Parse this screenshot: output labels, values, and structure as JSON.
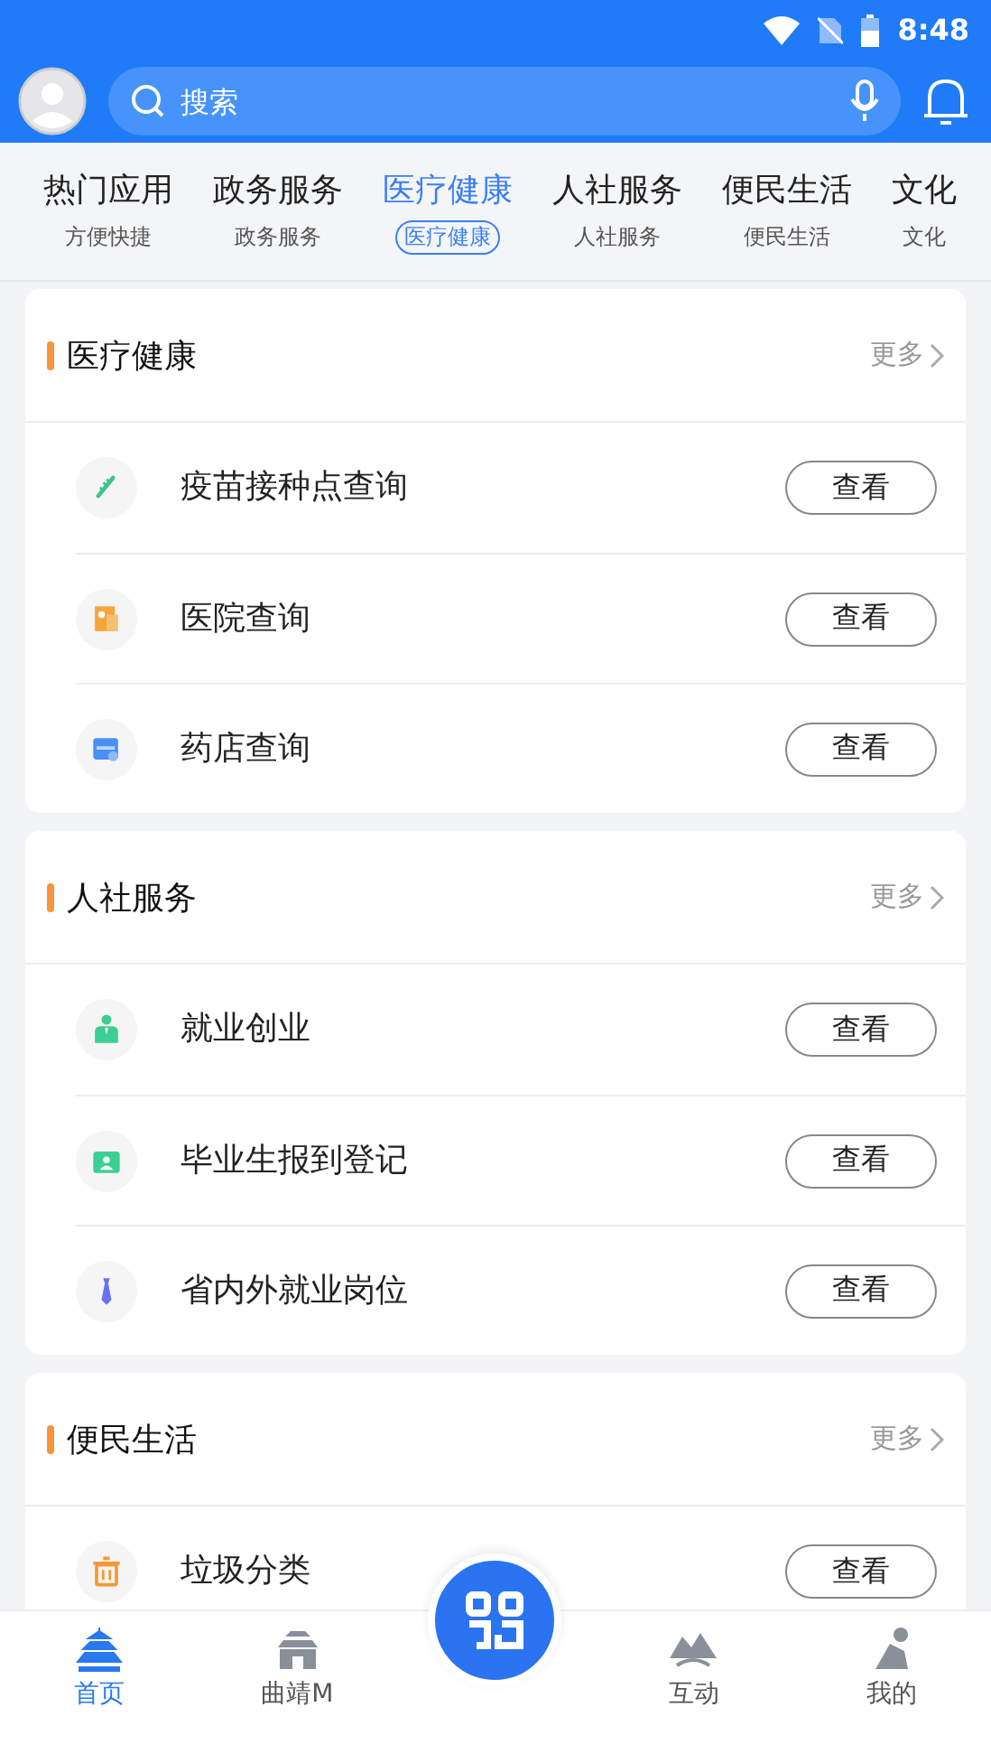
{
  "status_bar": {
    "time": "8:48"
  },
  "search": {
    "placeholder": "搜索"
  },
  "tabs": [
    {
      "label": "热门应用",
      "sub": "方便快捷",
      "selected": false
    },
    {
      "label": "政务服务",
      "sub": "政务服务",
      "selected": false
    },
    {
      "label": "医疗健康",
      "sub": "医疗健康",
      "selected": true
    },
    {
      "label": "人社服务",
      "sub": "人社服务",
      "selected": false
    },
    {
      "label": "便民生活",
      "sub": "便民生活",
      "selected": false
    },
    {
      "label": "文化",
      "sub": "文化",
      "selected": false
    }
  ],
  "sections": [
    {
      "title": "医疗健康",
      "more": "更多",
      "items": [
        {
          "kind": "syringe",
          "name": "疫苗接种点查询",
          "action": "查看"
        },
        {
          "kind": "hospital",
          "name": "医院查询",
          "action": "查看"
        },
        {
          "kind": "pharmacy",
          "name": "药店查询",
          "action": "查看"
        }
      ]
    },
    {
      "title": "人社服务",
      "more": "更多",
      "items": [
        {
          "kind": "worker",
          "name": "就业创业",
          "action": "查看"
        },
        {
          "kind": "badge",
          "name": "毕业生报到登记",
          "action": "查看"
        },
        {
          "kind": "tie",
          "name": "省内外就业岗位",
          "action": "查看"
        }
      ]
    },
    {
      "title": "便民生活",
      "more": "更多",
      "items": [
        {
          "kind": "trash",
          "name": "垃圾分类",
          "action": "查看"
        }
      ]
    }
  ],
  "nav": [
    {
      "kind": "temple",
      "label": "首页",
      "selected": true
    },
    {
      "kind": "gate",
      "label": "曲靖M",
      "selected": false
    },
    {
      "kind": "scan"
    },
    {
      "kind": "hills",
      "label": "互动",
      "selected": false
    },
    {
      "kind": "person",
      "label": "我的",
      "selected": false
    }
  ]
}
